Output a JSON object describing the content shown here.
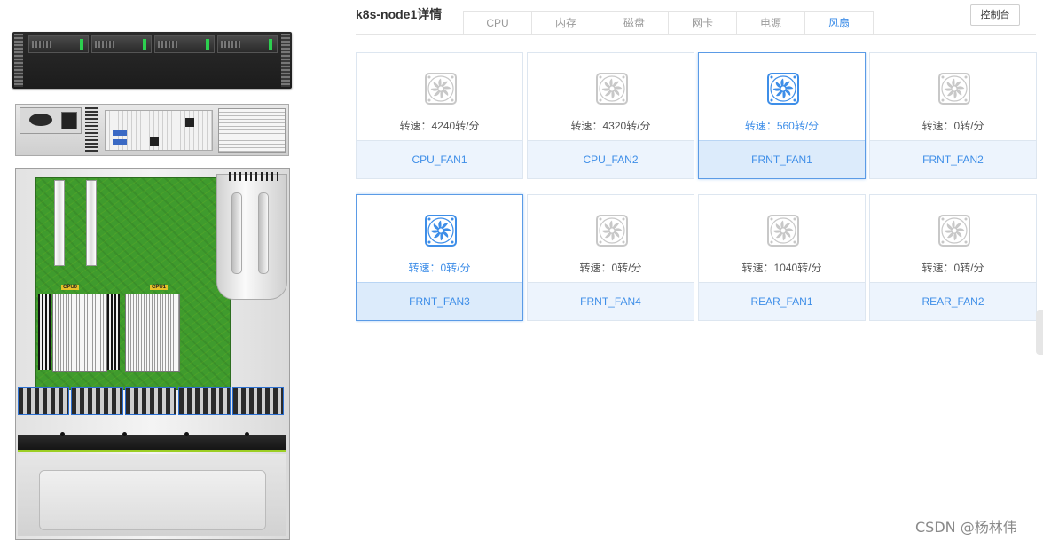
{
  "node_title": "k8s-node1详情",
  "tabs": [
    {
      "label": "CPU",
      "active": false
    },
    {
      "label": "内存",
      "active": false
    },
    {
      "label": "磁盘",
      "active": false
    },
    {
      "label": "网卡",
      "active": false
    },
    {
      "label": "电源",
      "active": false
    },
    {
      "label": "风扇",
      "active": true
    }
  ],
  "console_button": "控制台",
  "hardware_labels": {
    "cpu0": "CPU0",
    "cpu1": "CPU1"
  },
  "fans": [
    {
      "speed_text": "转速：4240转/分",
      "name": "CPU_FAN1",
      "active": false
    },
    {
      "speed_text": "转速：4320转/分",
      "name": "CPU_FAN2",
      "active": false
    },
    {
      "speed_text": "转速：560转/分",
      "name": "FRNT_FAN1",
      "active": true
    },
    {
      "speed_text": "转速：0转/分",
      "name": "FRNT_FAN2",
      "active": false
    },
    {
      "speed_text": "转速：0转/分",
      "name": "FRNT_FAN3",
      "active": true
    },
    {
      "speed_text": "转速：0转/分",
      "name": "FRNT_FAN4",
      "active": false
    },
    {
      "speed_text": "转速：1040转/分",
      "name": "REAR_FAN1",
      "active": false
    },
    {
      "speed_text": "转速：0转/分",
      "name": "REAR_FAN2",
      "active": false
    }
  ],
  "colors": {
    "accent": "#3e8ee8",
    "inactive_icon": "#c8c8c8",
    "card_footer": "#edf4fd"
  },
  "watermark": "CSDN @杨林伟"
}
